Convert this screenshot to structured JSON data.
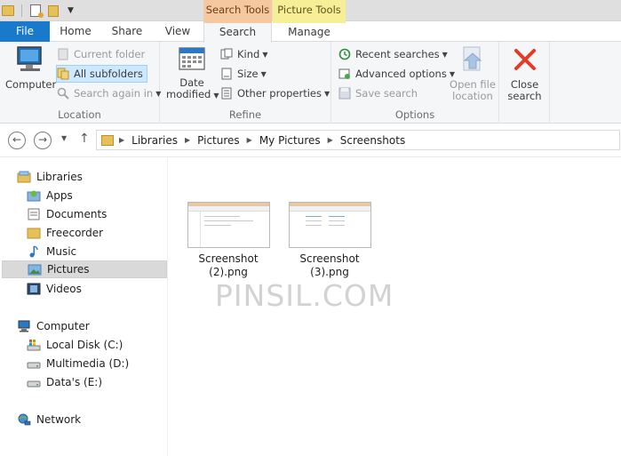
{
  "title_bar": {
    "context_tabs": [
      "Search Tools",
      "Picture Tools"
    ]
  },
  "tabs": {
    "file": "File",
    "home": "Home",
    "share": "Share",
    "view": "View",
    "search": "Search",
    "manage": "Manage"
  },
  "ribbon": {
    "location": {
      "computer": "Computer",
      "current_folder": "Current folder",
      "all_subfolders": "All subfolders",
      "search_again": "Search again in",
      "group_label": "Location"
    },
    "refine": {
      "date_modified_1": "Date",
      "date_modified_2": "modified",
      "kind": "Kind",
      "size": "Size",
      "other_properties": "Other properties",
      "group_label": "Refine"
    },
    "options": {
      "recent_searches": "Recent searches",
      "advanced_options": "Advanced options",
      "save_search": "Save search",
      "open_file_location_1": "Open file",
      "open_file_location_2": "location",
      "group_label": "Options"
    },
    "close": {
      "label_1": "Close",
      "label_2": "search"
    }
  },
  "address": {
    "crumbs": [
      "Libraries",
      "Pictures",
      "My Pictures",
      "Screenshots"
    ]
  },
  "sidebar": {
    "libraries": "Libraries",
    "apps": "Apps",
    "documents": "Documents",
    "freecorder": "Freecorder",
    "music": "Music",
    "pictures": "Pictures",
    "videos": "Videos",
    "computer": "Computer",
    "local_disk": "Local Disk (C:)",
    "multimedia": "Multimedia (D:)",
    "datas": "Data's (E:)",
    "network": "Network"
  },
  "files": [
    {
      "line1": "Screenshot",
      "line2": "(2).png"
    },
    {
      "line1": "Screenshot",
      "line2": "(3).png"
    }
  ],
  "watermark": "PINSIL.COM",
  "colors": {
    "file_tab": "#1979ca",
    "search_tools": "#f6c8a0",
    "picture_tools": "#f7ef96",
    "close_x": "#e23b2a"
  }
}
